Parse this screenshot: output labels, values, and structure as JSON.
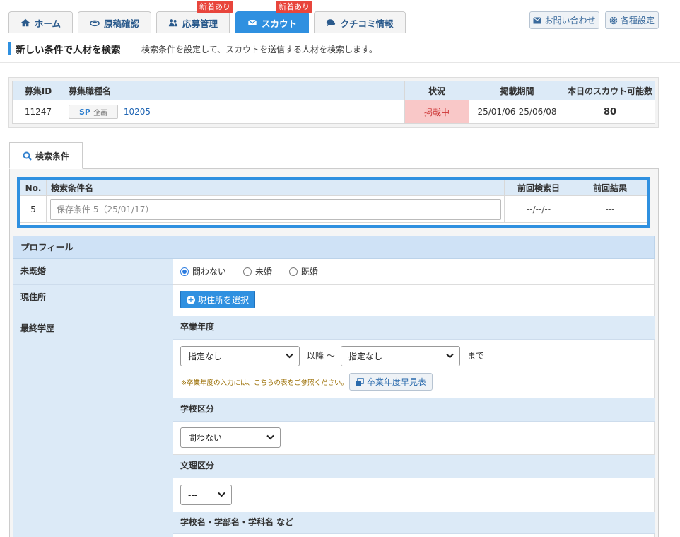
{
  "nav": {
    "tabs": [
      {
        "label": "ホーム",
        "icon": "home-icon"
      },
      {
        "label": "原稿確認",
        "icon": "manuscript-icon"
      },
      {
        "label": "応募管理",
        "icon": "users-icon",
        "badge": "新着あり"
      },
      {
        "label": "スカウト",
        "icon": "mail-icon",
        "badge": "新着あり",
        "active": true
      },
      {
        "label": "クチコミ情報",
        "icon": "chat-icon"
      }
    ],
    "contact_label": "お問い合わせ",
    "settings_label": "各種設定"
  },
  "page": {
    "title": "新しい条件で人材を検索",
    "description": "検索条件を設定して、スカウトを送信する人材を検索します。"
  },
  "job_table": {
    "headers": [
      "募集ID",
      "募集職種名",
      "状況",
      "掲載期間",
      "本日のスカウト可能数"
    ],
    "row": {
      "id": "11247",
      "sp_label": "SP",
      "sp_sub": "企画",
      "job_name": "10205",
      "status": "掲載中",
      "period": "25/01/06-25/06/08",
      "scout_count": "80"
    }
  },
  "search_tab": {
    "label": "検索条件"
  },
  "condition_table": {
    "headers": [
      "No.",
      "検索条件名",
      "前回検索日",
      "前回結果"
    ],
    "row": {
      "no": "5",
      "name_value": "保存条件 5（25/01/17）",
      "last_date": "--/--/--",
      "last_result": "---"
    }
  },
  "profile": {
    "section_title": "プロフィール",
    "marital": {
      "label": "未既婚",
      "options": [
        "問わない",
        "未婚",
        "既婚"
      ],
      "selected": 0
    },
    "address": {
      "label": "現住所",
      "button": "現住所を選択"
    },
    "education": {
      "label": "最終学歴",
      "grad_year": {
        "title": "卒業年度",
        "from_value": "指定なし",
        "middle_text": "以降 ～",
        "to_value": "指定なし",
        "end_text": "まで",
        "note": "※卒業年度の入力には、こちらの表をご参照ください。",
        "table_button": "卒業年度早見表"
      },
      "school_type": {
        "title": "学校区分",
        "value": "問わない"
      },
      "bunri": {
        "title": "文理区分",
        "value": "---"
      },
      "school_name": {
        "title": "学校名・学部名・学科名 など"
      }
    }
  },
  "colors": {
    "accent": "#2f90e0",
    "header_bg": "#dceaf7",
    "badge": "#e8453c",
    "status_bg": "#f9c8c8"
  }
}
